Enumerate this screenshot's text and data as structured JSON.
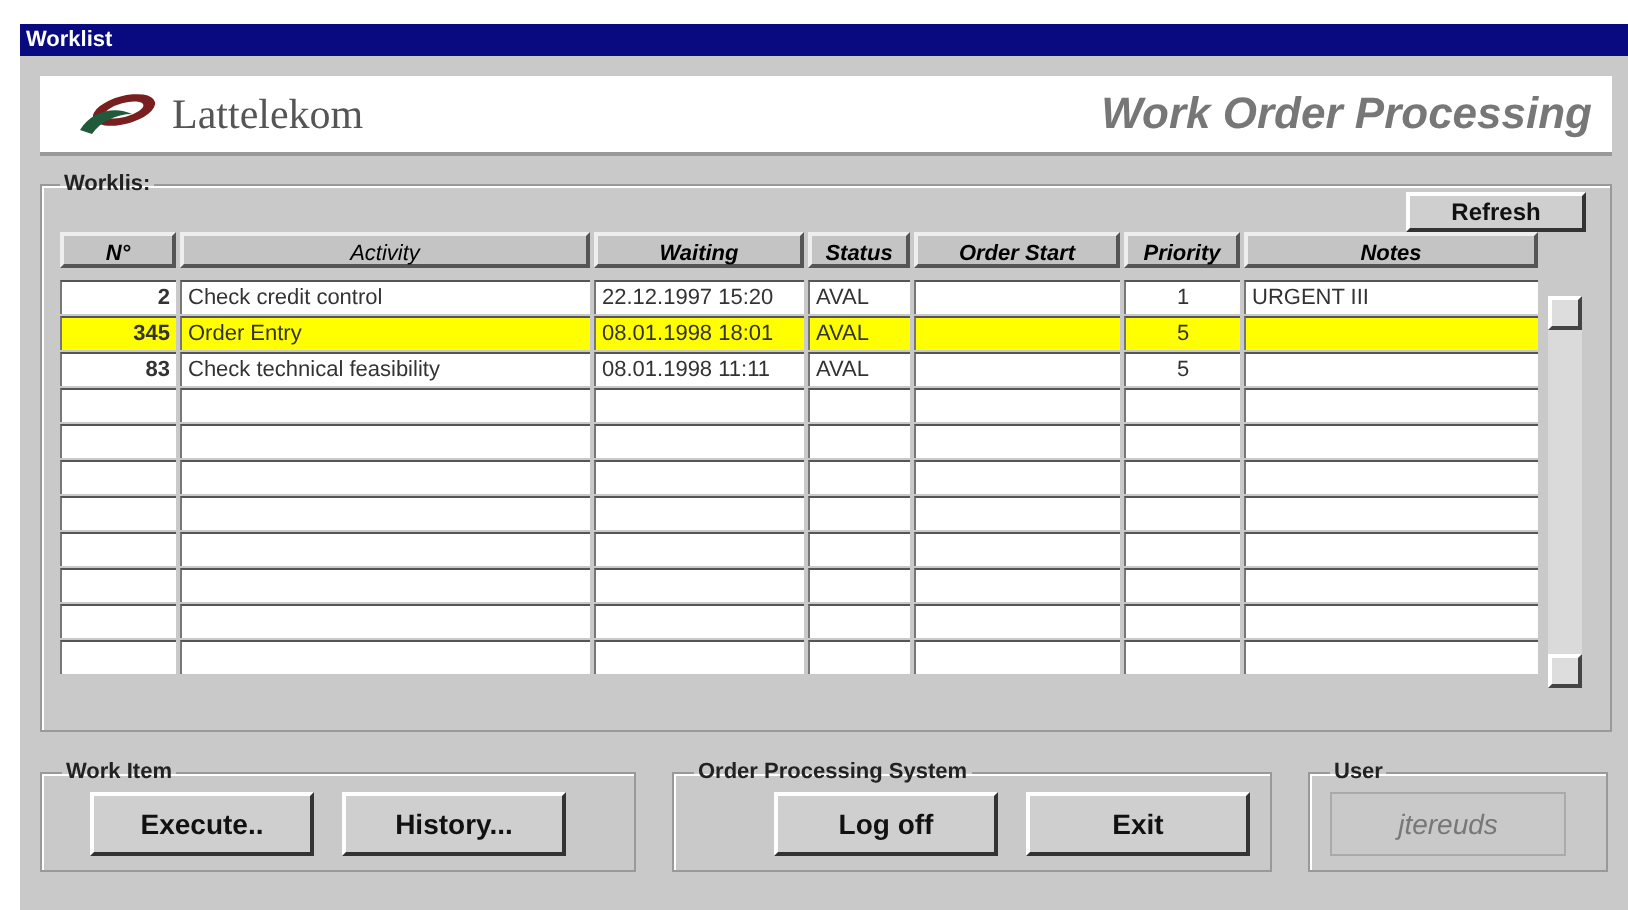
{
  "window": {
    "title": "Worklist"
  },
  "banner": {
    "company": "Lattelekom",
    "heading": "Work Order Processing"
  },
  "worklist": {
    "legend": "Worklis:",
    "refresh_button": "Refresh",
    "columns": [
      "N°",
      "Activity",
      "Waiting",
      "Status",
      "Order Start",
      "Priority",
      "Notes"
    ],
    "rows": [
      {
        "number": "2",
        "activity": "Check credit control",
        "waiting": "22.12.1997 15:20",
        "status": "AVAL",
        "priority": "1",
        "notes": "URGENT III",
        "selected": false
      },
      {
        "number": "345",
        "activity": "Order Entry",
        "waiting": "08.01.1998 18:01",
        "status": "AVAL",
        "priority": "5",
        "selected": true
      },
      {
        "number": "83",
        "activity": "Check technical feasibility",
        "waiting": "08.01.1998 11:11",
        "status": "AVAL",
        "priority": "5",
        "selected": false
      }
    ]
  },
  "work_item": {
    "legend": "Work Item",
    "buttons": [
      "Execute..",
      "History..."
    ]
  },
  "order_processing_system": {
    "legend": "Order Processing System",
    "buttons": [
      "Log off",
      "Exit"
    ]
  },
  "user": {
    "legend": "User",
    "name": "jtereuds"
  }
}
